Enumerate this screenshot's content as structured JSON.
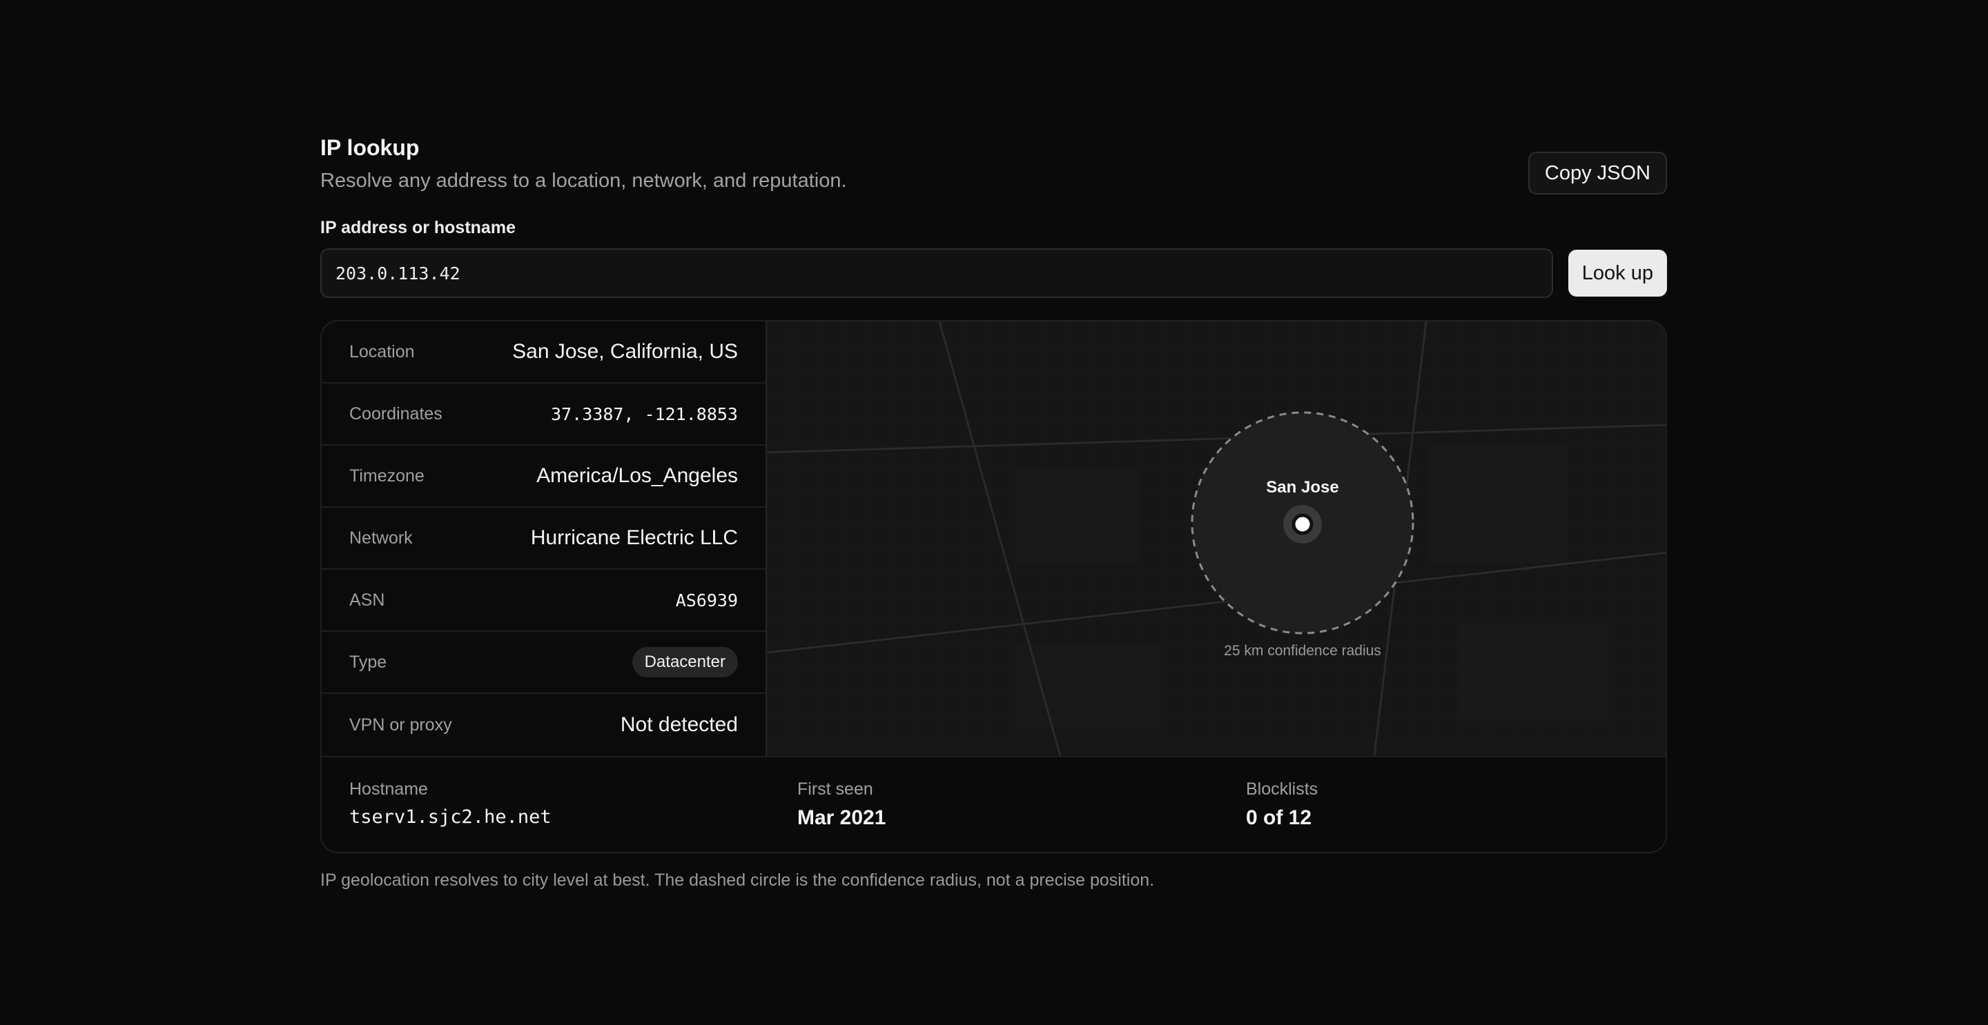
{
  "header": {
    "title": "IP lookup",
    "subtitle": "Resolve any address to a location, network, and reputation.",
    "copy_label": "Copy JSON"
  },
  "search": {
    "label": "IP address or hostname",
    "value": "203.0.113.42",
    "button_label": "Look up"
  },
  "details": [
    {
      "label": "Location",
      "value": "San Jose, California, US"
    },
    {
      "label": "Coordinates",
      "value": "37.3387, -121.8853"
    },
    {
      "label": "Timezone",
      "value": "America/Los_Angeles"
    },
    {
      "label": "Network",
      "value": "Hurricane Electric LLC"
    },
    {
      "label": "ASN",
      "value": "AS6939"
    },
    {
      "label": "Type",
      "value": "Datacenter"
    },
    {
      "label": "VPN or proxy",
      "value": "Not detected"
    }
  ],
  "map": {
    "pin_label": "San Jose",
    "radius_caption": "25 km confidence radius"
  },
  "footer": {
    "hostname_label": "Hostname",
    "hostname_value": "tserv1.sjc2.he.net",
    "first_seen_label": "First seen",
    "first_seen_value": "Mar 2021",
    "blocklists_label": "Blocklists",
    "blocklists_value": "0 of 12"
  },
  "note": "IP geolocation resolves to city level at best. The dashed circle is the confidence radius, not a precise position."
}
